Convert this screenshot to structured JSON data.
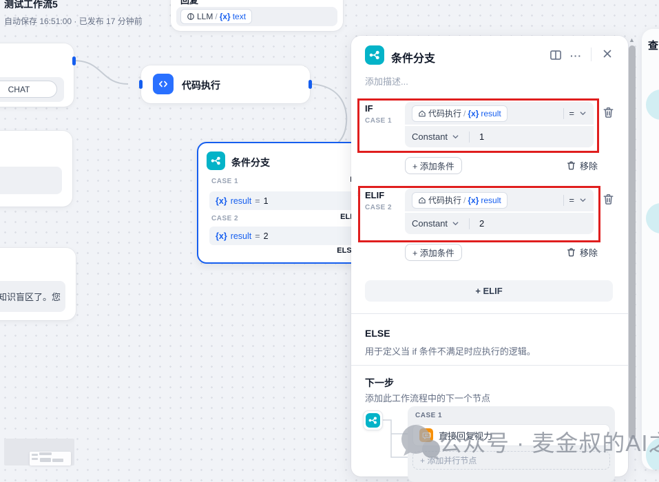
{
  "app": {
    "title": "测试工作流5",
    "autosave": "自动保存 16:51:00 · 已发布 17 分钟前"
  },
  "canvas": {
    "chat_node": {
      "tag": "CHAT"
    },
    "reply_node": {
      "title": "回复",
      "pill": {
        "model": "LLM",
        "sep": "/",
        "var": "{x}",
        "field": "text"
      }
    },
    "code_node": {
      "title": "代码执行"
    },
    "branch_node": {
      "title": "条件分支",
      "else_kw": "ELSE",
      "cases": [
        {
          "label": "CASE 1",
          "kw": "IF",
          "var": "{x}",
          "name": "result",
          "op": "=",
          "value": "1"
        },
        {
          "label": "CASE 2",
          "kw": "ELIF",
          "var": "{x}",
          "name": "result",
          "op": "=",
          "value": "2"
        }
      ]
    },
    "snippet_card": {
      "text": "知识盲区了。您"
    }
  },
  "panel": {
    "title": "条件分支",
    "description_placeholder": "添加描述...",
    "cases": [
      {
        "kw": "IF",
        "case_label": "CASE 1",
        "source_node": "代码执行",
        "sep": "/",
        "var_prefix": "{x}",
        "var_name": "result",
        "operator": "=",
        "value_type": "Constant",
        "value": "1"
      },
      {
        "kw": "ELIF",
        "case_label": "CASE 2",
        "source_node": "代码执行",
        "sep": "/",
        "var_prefix": "{x}",
        "var_name": "result",
        "operator": "=",
        "value_type": "Constant",
        "value": "2"
      }
    ],
    "add_condition_label": "+ 添加条件",
    "remove_label": "移除",
    "add_elif_label": "+ ELIF",
    "else_block": {
      "title": "ELSE",
      "desc": "用于定义当 if 条件不满足时应执行的逻辑。"
    },
    "next_step": {
      "title": "下一步",
      "desc": "添加此工作流程中的下一个节点",
      "case_label": "CASE 1",
      "node_label": "直接回复视力",
      "add_parallel_label": "+ 添加并行节点"
    }
  },
  "side_peek": {
    "char": "查"
  },
  "watermark": {
    "text": "公众号 · 麦金叔的AI之旅"
  },
  "colors": {
    "accent_blue": "#155eef",
    "branch_teal": "#04b3c8",
    "code_blue": "#2970ff",
    "answer_orange": "#f79009",
    "annotation_red": "#e01e1e"
  }
}
